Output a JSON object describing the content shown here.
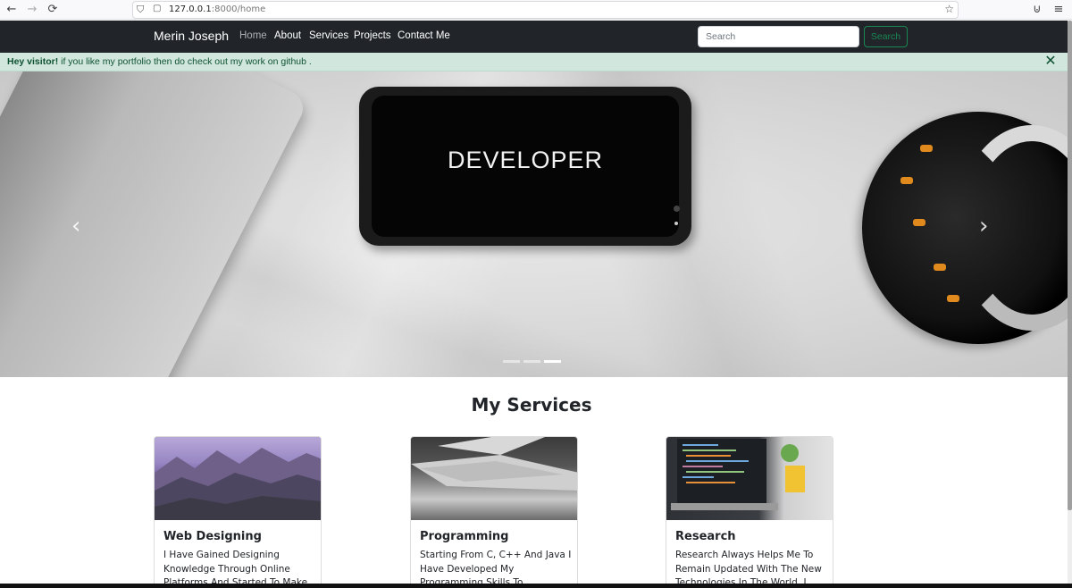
{
  "browser": {
    "url_host": "127.0.0.1",
    "url_rest": ":8000/home",
    "back_icon": "arrow-left-icon",
    "forward_icon": "arrow-right-icon",
    "reload_icon": "reload-icon"
  },
  "navbar": {
    "brand": "Merin Joseph",
    "links": [
      "Home",
      "About",
      "Services",
      "Projects",
      "Contact Me"
    ],
    "search_placeholder": "Search",
    "search_button": "Search"
  },
  "alert": {
    "strong": "Hey visitor!",
    "message": " if you like my portfolio then do check out my work on github ."
  },
  "carousel": {
    "slide_text": "DEVELOPER",
    "prev": "‹",
    "next": "›",
    "indicator_count": 3,
    "active_indicator": 3
  },
  "services": {
    "title": "My Services",
    "cards": [
      {
        "title": "Web Designing",
        "text": "I Have Gained Designing Knowledge Through Online Platforms And Started To Make"
      },
      {
        "title": "Programming",
        "text": "Starting From C, C++ And Java I Have Developed My Programming Skills To Languages Like Javascript"
      },
      {
        "title": "Research",
        "text": "Research Always Helps Me To Remain Updated With The New Technologies In The World. I Love"
      }
    ]
  }
}
